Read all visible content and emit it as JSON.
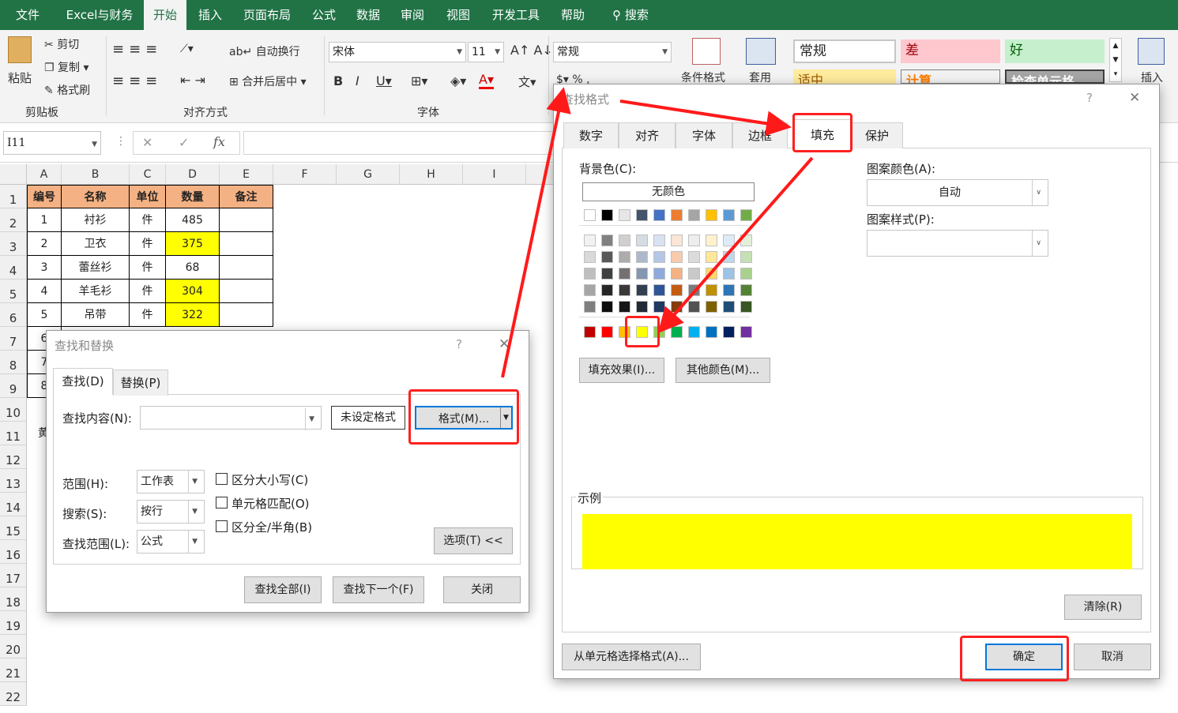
{
  "menu": [
    "文件",
    "Excel与财务",
    "开始",
    "插入",
    "页面布局",
    "公式",
    "数据",
    "审阅",
    "视图",
    "开发工具",
    "帮助",
    "搜索"
  ],
  "ribbon": {
    "paste": "粘贴",
    "cut": "剪切",
    "copy": "复制",
    "format_painter": "格式刷",
    "clipboard_group": "剪贴板",
    "wrap_text": "自动换行",
    "merge_center": "合并后居中",
    "align_group": "对齐方式",
    "font_name": "宋体",
    "font_size": "11",
    "font_group": "字体",
    "number_format": "常规",
    "cond_format": "条件格式",
    "table_format": "套用",
    "insert": "插入",
    "styles": [
      "常规",
      "差",
      "好",
      "适中",
      "计算",
      "检查单元格"
    ]
  },
  "formula": {
    "namebox": "I11",
    "cancel": "✕",
    "enter": "✓",
    "fx": "fx"
  },
  "columns": [
    "A",
    "B",
    "C",
    "D",
    "E",
    "F",
    "G",
    "H",
    "I"
  ],
  "rows": [
    "1",
    "2",
    "3",
    "4",
    "5",
    "6",
    "7",
    "8",
    "9",
    "10",
    "11",
    "12",
    "13",
    "14",
    "15",
    "16",
    "17",
    "18",
    "19",
    "20",
    "21",
    "22"
  ],
  "table": {
    "headers": [
      "编号",
      "名称",
      "单位",
      "数量",
      "备注"
    ],
    "data": [
      [
        "1",
        "衬衫",
        "件",
        "485",
        ""
      ],
      [
        "2",
        "卫衣",
        "件",
        "375",
        ""
      ],
      [
        "3",
        "蕾丝衫",
        "件",
        "68",
        ""
      ],
      [
        "4",
        "羊毛衫",
        "件",
        "304",
        ""
      ],
      [
        "5",
        "吊带",
        "件",
        "322",
        ""
      ]
    ],
    "highlight_rows": [
      1,
      3,
      4
    ]
  },
  "partial": {
    "r7": "6",
    "r8": "7",
    "r9": "8",
    "r11": "黄"
  },
  "find": {
    "title": "查找和替换",
    "help": "?",
    "close": "✕",
    "tab_find": "查找(D)",
    "tab_replace": "替换(P)",
    "content_label": "查找内容(N):",
    "content_value": "",
    "no_format": "未设定格式",
    "format_btn": "格式(M)...",
    "scope_label": "范围(H):",
    "scope_val": "工作表",
    "search_label": "搜索(S):",
    "search_val": "按行",
    "lookin_label": "查找范围(L):",
    "lookin_val": "公式",
    "case": "区分大小写(C)",
    "whole": "单元格匹配(O)",
    "width": "区分全/半角(B)",
    "options": "选项(T) <<",
    "find_all": "查找全部(I)",
    "find_next": "查找下一个(F)",
    "close_btn": "关闭"
  },
  "fmt": {
    "title": "查找格式",
    "help": "?",
    "close": "✕",
    "tabs": [
      "数字",
      "对齐",
      "字体",
      "边框",
      "填充",
      "保护"
    ],
    "bg_label": "背景色(C):",
    "no_color": "无颜色",
    "pattern_color_label": "图案颜色(A):",
    "pattern_color_val": "自动",
    "pattern_style_label": "图案样式(P):",
    "fill_effects": "填充效果(I)...",
    "more_colors": "其他颜色(M)...",
    "sample_label": "示例",
    "sample_color": "#ffff00",
    "clear": "清除(R)",
    "pick_from_cell": "从单元格选择格式(A)...",
    "ok": "确定",
    "cancel": "取消"
  },
  "palette": {
    "theme_top": [
      "#ffffff",
      "#000000",
      "#e7e6e6",
      "#44546a",
      "#4472c4",
      "#ed7d31",
      "#a5a5a5",
      "#ffc000",
      "#5b9bd5",
      "#70ad47"
    ],
    "theme_shades": [
      [
        "#f2f2f2",
        "#808080",
        "#d0cece",
        "#d6dce4",
        "#d9e2f3",
        "#fbe5d6",
        "#ededed",
        "#fff2cc",
        "#deebf7",
        "#e2f0d9"
      ],
      [
        "#d9d9d9",
        "#595959",
        "#aeabab",
        "#adb9ca",
        "#b4c7e7",
        "#f8cbad",
        "#dbdbdb",
        "#ffe699",
        "#bdd7ee",
        "#c5e0b4"
      ],
      [
        "#bfbfbf",
        "#404040",
        "#757171",
        "#8497b0",
        "#8faadc",
        "#f4b183",
        "#c9c9c9",
        "#ffd966",
        "#9dc3e6",
        "#a9d18e"
      ],
      [
        "#a6a6a6",
        "#262626",
        "#3a3838",
        "#333f50",
        "#2f5597",
        "#c55a11",
        "#7b7b7b",
        "#bf9000",
        "#2e75b6",
        "#548235"
      ],
      [
        "#7f7f7f",
        "#0d0d0d",
        "#171616",
        "#222a35",
        "#1f3864",
        "#843c0c",
        "#525252",
        "#7f6000",
        "#1f4e79",
        "#385723"
      ]
    ],
    "standard": [
      "#c00000",
      "#ff0000",
      "#ffc000",
      "#ffff00",
      "#92d050",
      "#00b050",
      "#00b0f0",
      "#0070c0",
      "#002060",
      "#7030a0"
    ]
  }
}
